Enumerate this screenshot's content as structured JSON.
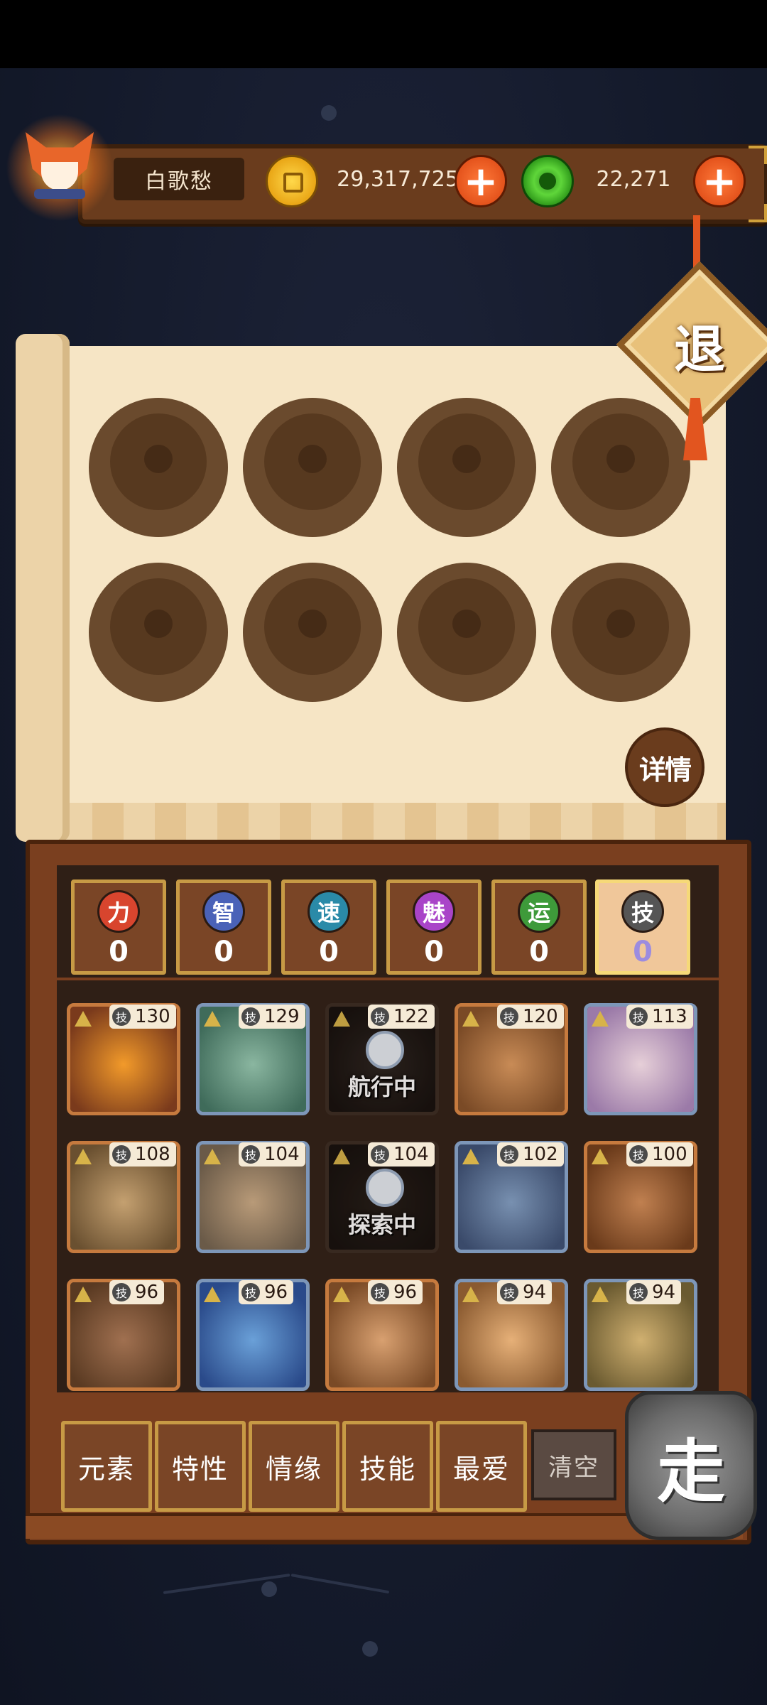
{
  "player": {
    "name": "白歌愁"
  },
  "currency": {
    "gold": "29,317,725",
    "jade": "22,271",
    "add_symbol": "+"
  },
  "exit_label": "退",
  "detail_label": "详情",
  "stats": [
    {
      "icon_label": "力",
      "value": "0",
      "color": "#d8452e"
    },
    {
      "icon_label": "智",
      "value": "0",
      "color": "#4a62b8"
    },
    {
      "icon_label": "速",
      "value": "0",
      "color": "#2a8aa8"
    },
    {
      "icon_label": "魅",
      "value": "0",
      "color": "#a944c8"
    },
    {
      "icon_label": "运",
      "value": "0",
      "color": "#3e9a3a"
    },
    {
      "icon_label": "技",
      "value": "0",
      "color": "#555555"
    }
  ],
  "skill_icon_label": "技",
  "heroes": [
    {
      "skill": "130",
      "status": ""
    },
    {
      "skill": "129",
      "status": ""
    },
    {
      "skill": "122",
      "status": "航行中"
    },
    {
      "skill": "120",
      "status": ""
    },
    {
      "skill": "113",
      "status": ""
    },
    {
      "skill": "108",
      "status": ""
    },
    {
      "skill": "104",
      "status": ""
    },
    {
      "skill": "104",
      "status": "探索中"
    },
    {
      "skill": "102",
      "status": ""
    },
    {
      "skill": "100",
      "status": ""
    },
    {
      "skill": "96",
      "status": ""
    },
    {
      "skill": "96",
      "status": ""
    },
    {
      "skill": "96",
      "status": ""
    },
    {
      "skill": "94",
      "status": ""
    },
    {
      "skill": "94",
      "status": ""
    }
  ],
  "filters": [
    "元素",
    "特性",
    "情缘",
    "技能",
    "最爱"
  ],
  "clear_label": "清空",
  "go_label": "走"
}
